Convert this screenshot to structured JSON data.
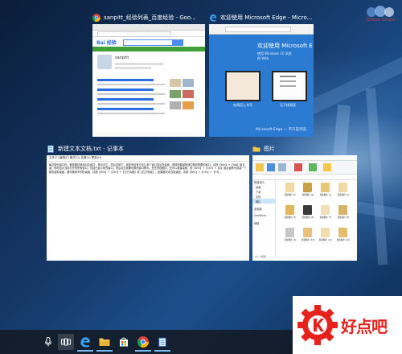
{
  "watermark": {
    "text": "3Dmax Simple",
    "site_logo": "好点吧"
  },
  "windows": {
    "chrome": {
      "title": "sanpitt_经验列表_百度经验 - Goo...",
      "icon": "chrome-icon",
      "page": {
        "logo": "Bai 经验",
        "user": "sanpitt"
      }
    },
    "edge": {
      "title": "欢迎使用 Microsoft Edge - Micro...",
      "icon": "edge-icon",
      "page": {
        "headline": "欢迎使用 Microsoft E",
        "sub1": "使用 Windows 10 浏览",
        "sub2": "的 Web",
        "card1": "在网页上书写",
        "card2": "无干扰阅读",
        "footer": "Microsoft Edge — 不只是浏览"
      }
    },
    "notepad": {
      "title": "新建文本文档.txt - 记事本",
      "icon": "notepad-icon",
      "menu": "文件(F) 编辑(E) 格式(O) 查看(V) 帮助(H)",
      "body_text": "每次操作窗口时，都需要切换到对应窗口，再点击它，然后关闭它，到底有没有方法让多个窗口显示在桌面，再按快捷键快速切换到需要的窗口，请按【Win】+【Tab】组合键，即可显示当前打开的所有窗口，包括已最小化的窗口，然后点击需要切换的窗口即可。在任务视图中，还可以新建桌面，按【Win】+【Ctrl】+【D】组合键即可创建一个新的虚拟桌面，要切换到不同的桌面，请按【Win】+【Ctrl】+【左方向键】或【右方向键】。如果要关闭当前桌面，请按【Win】+【Ctrl】+【F4】。"
    },
    "explorer": {
      "title": "图片",
      "icon": "folder-icon",
      "sidebar": [
        "快速访问",
        "桌面",
        "下载",
        "文档",
        "图片",
        "此电脑",
        "OneDrive",
        "网络"
      ],
      "files": [
        "新建图片 (1)",
        "新建图片 (2)",
        "新建图片 (3)",
        "新建图片 (4)",
        "新建图片 (5)",
        "新建图片 (6)",
        "新建图片 (7)",
        "新建图片 (8)",
        "新建图片 (9)",
        "新建图片 (10)",
        "新建图片 (11)",
        "新建图片 (12)"
      ],
      "status": "12 个项目"
    }
  },
  "taskbar": {
    "items": [
      "microphone-icon",
      "task-view-icon",
      "edge-icon",
      "explorer-icon",
      "store-icon",
      "chrome-icon",
      "notepad-icon"
    ]
  },
  "colors": {
    "accent": "#0078d7",
    "taskbar": "#141c28",
    "logo_red": "#e8211d"
  }
}
